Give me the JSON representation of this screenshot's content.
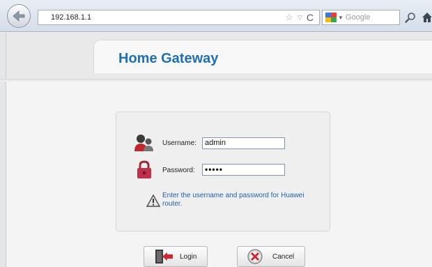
{
  "browser": {
    "url": "192.168.1.1",
    "search_engine": "Google",
    "search_placeholder": "Google"
  },
  "header": {
    "title": "Home Gateway"
  },
  "login": {
    "username_label": "Username:",
    "username_value": "admin",
    "password_label": "Password:",
    "password_masked": "•••••",
    "hint": "Enter the username and password for Huawei router."
  },
  "buttons": {
    "login_label": "Login",
    "cancel_label": "Cancel"
  },
  "icons": {
    "back": "back-arrow-icon",
    "bookmark": "star-icon",
    "history": "dropmarker-icon",
    "reload": "reload-icon",
    "search_engine": "google-icon",
    "search": "magnifier-icon",
    "home": "home-icon",
    "user": "user-icon",
    "lock": "lock-icon",
    "warning": "warning-icon",
    "login": "door-arrow-icon",
    "cancel": "cancel-icon"
  },
  "colors": {
    "title": "#1f6fb4",
    "hint": "#2160a8"
  }
}
